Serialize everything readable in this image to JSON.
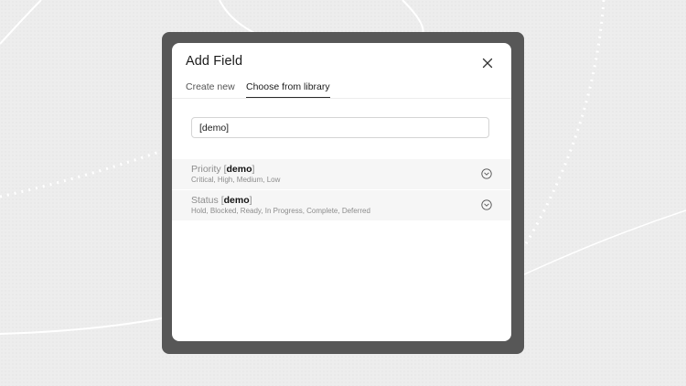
{
  "dialog": {
    "title": "Add Field",
    "close_icon": "close-icon"
  },
  "tabs": [
    {
      "label": "Create new",
      "active": false
    },
    {
      "label": "Choose from library",
      "active": true
    }
  ],
  "search": {
    "value": "[demo]"
  },
  "library_items": [
    {
      "name": "Priority",
      "bracket_open": "[",
      "tag": "demo",
      "bracket_close": "]",
      "options": "Critical, High, Medium, Low",
      "icon": "chevron-down-circle-icon"
    },
    {
      "name": "Status",
      "bracket_open": "[",
      "tag": "demo",
      "bracket_close": "]",
      "options": "Hold, Blocked, Ready, In Progress, Complete, Deferred",
      "icon": "chevron-down-circle-icon"
    }
  ],
  "colors": {
    "backdrop": "#ececec",
    "frame": "#575757",
    "dialog": "#ffffff",
    "row": "#f6f6f6",
    "muted_text": "#8c8c8c"
  }
}
